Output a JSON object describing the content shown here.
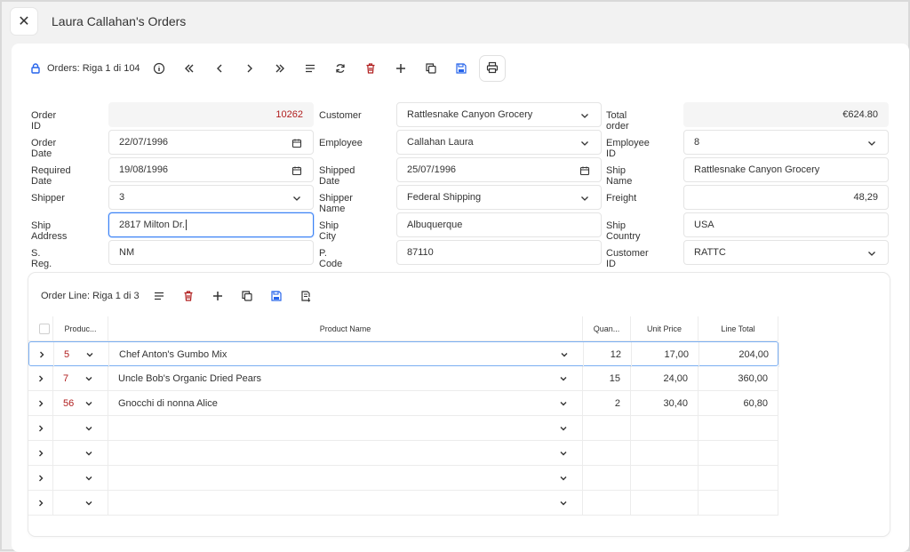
{
  "window": {
    "title": "Laura Callahan's Orders"
  },
  "toolbar": {
    "label": "Orders: Riga 1 di 104"
  },
  "colors": {
    "accent": "#3b82f6",
    "danger": "#b01d1d",
    "save": "#2563eb"
  },
  "form": {
    "order_id": {
      "label": "Order ID",
      "value": "10262"
    },
    "customer": {
      "label": "Customer",
      "value": "Rattlesnake Canyon Grocery"
    },
    "total_order": {
      "label": "Total order",
      "value": "€624.80"
    },
    "order_date": {
      "label": "Order Date",
      "value": "22/07/1996"
    },
    "employee": {
      "label": "Employee",
      "value": "Callahan Laura"
    },
    "employee_id": {
      "label": "Employee ID",
      "value": "8"
    },
    "required_date": {
      "label": "Required Date",
      "value": "19/08/1996"
    },
    "shipped_date": {
      "label": "Shipped Date",
      "value": "25/07/1996"
    },
    "ship_name": {
      "label": "Ship Name",
      "value": "Rattlesnake Canyon Grocery"
    },
    "shipper": {
      "label": "Shipper",
      "value": "3"
    },
    "shipper_name": {
      "label": "Shipper Name",
      "value": "Federal Shipping"
    },
    "freight": {
      "label": "Freight",
      "value": "48,29"
    },
    "ship_address": {
      "label": "Ship Address",
      "value": "2817 Milton Dr."
    },
    "ship_city": {
      "label": "Ship City",
      "value": "Albuquerque"
    },
    "ship_country": {
      "label": "Ship Country",
      "value": "USA"
    },
    "s_reg": {
      "label": "S. Reg.",
      "value": "NM"
    },
    "p_code": {
      "label": "P. Code",
      "value": "87110"
    },
    "customer_id": {
      "label": "Customer ID",
      "value": "RATTC"
    }
  },
  "order_lines": {
    "label": "Order Line: Riga 1 di 3",
    "columns": {
      "product": "Produc...",
      "product_name": "Product Name",
      "quantity": "Quan...",
      "unit_price": "Unit Price",
      "line_total": "Line Total"
    },
    "rows": [
      {
        "product": "5",
        "product_name": "Chef Anton's Gumbo Mix",
        "quantity": "12",
        "unit_price": "17,00",
        "line_total": "204,00"
      },
      {
        "product": "7",
        "product_name": "Uncle Bob's Organic Dried Pears",
        "quantity": "15",
        "unit_price": "24,00",
        "line_total": "360,00"
      },
      {
        "product": "56",
        "product_name": "Gnocchi di nonna Alice",
        "quantity": "2",
        "unit_price": "30,40",
        "line_total": "60,80"
      },
      {
        "product": "",
        "product_name": "",
        "quantity": "",
        "unit_price": "",
        "line_total": ""
      },
      {
        "product": "",
        "product_name": "",
        "quantity": "",
        "unit_price": "",
        "line_total": ""
      },
      {
        "product": "",
        "product_name": "",
        "quantity": "",
        "unit_price": "",
        "line_total": ""
      },
      {
        "product": "",
        "product_name": "",
        "quantity": "",
        "unit_price": "",
        "line_total": ""
      }
    ]
  }
}
